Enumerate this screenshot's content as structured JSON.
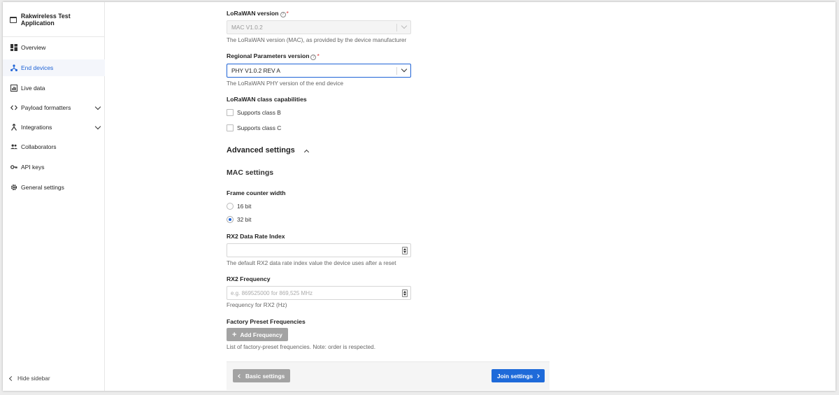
{
  "sidebar": {
    "app_title": "Rakwireless Test Application",
    "items": [
      {
        "label": "Overview",
        "icon": "dashboard-icon",
        "active": false
      },
      {
        "label": "End devices",
        "icon": "devices-icon",
        "active": true
      },
      {
        "label": "Live data",
        "icon": "live-data-icon",
        "active": false
      },
      {
        "label": "Payload formatters",
        "icon": "code-icon",
        "active": false,
        "expandable": true
      },
      {
        "label": "Integrations",
        "icon": "integrations-icon",
        "active": false,
        "expandable": true
      },
      {
        "label": "Collaborators",
        "icon": "people-icon",
        "active": false
      },
      {
        "label": "API keys",
        "icon": "key-icon",
        "active": false
      },
      {
        "label": "General settings",
        "icon": "gear-icon",
        "active": false
      }
    ],
    "hide_label": "Hide sidebar"
  },
  "form": {
    "lorawan_version": {
      "label": "LoRaWAN version",
      "value": "MAC V1.0.2",
      "help": "The LoRaWAN version (MAC), as provided by the device manufacturer"
    },
    "regional_params": {
      "label": "Regional Parameters version",
      "value": "PHY V1.0.2 REV A",
      "help": "The LoRaWAN PHY version of the end device"
    },
    "class_caps": {
      "label": "LoRaWAN class capabilities",
      "class_b": "Supports class B",
      "class_c": "Supports class C"
    },
    "advanced_title": "Advanced settings",
    "mac_title": "MAC settings",
    "frame_counter": {
      "label": "Frame counter width",
      "options": [
        "16 bit",
        "32 bit"
      ],
      "selected": "32 bit"
    },
    "rx2_dr": {
      "label": "RX2 Data Rate Index",
      "value": "",
      "help": "The default RX2 data rate index value the device uses after a reset"
    },
    "rx2_freq": {
      "label": "RX2 Frequency",
      "placeholder": "e.g. 869525000 for 869,525 MHz",
      "help": "Frequency for RX2 (Hz)"
    },
    "factory_freq": {
      "label": "Factory Preset Frequencies",
      "button": "Add Frequency",
      "help": "List of factory-preset frequencies. Note: order is respected."
    }
  },
  "footer": {
    "back_label": "Basic settings",
    "next_label": "Join settings"
  },
  "colors": {
    "accent": "#1e6ad9",
    "required": "#dd3333"
  }
}
